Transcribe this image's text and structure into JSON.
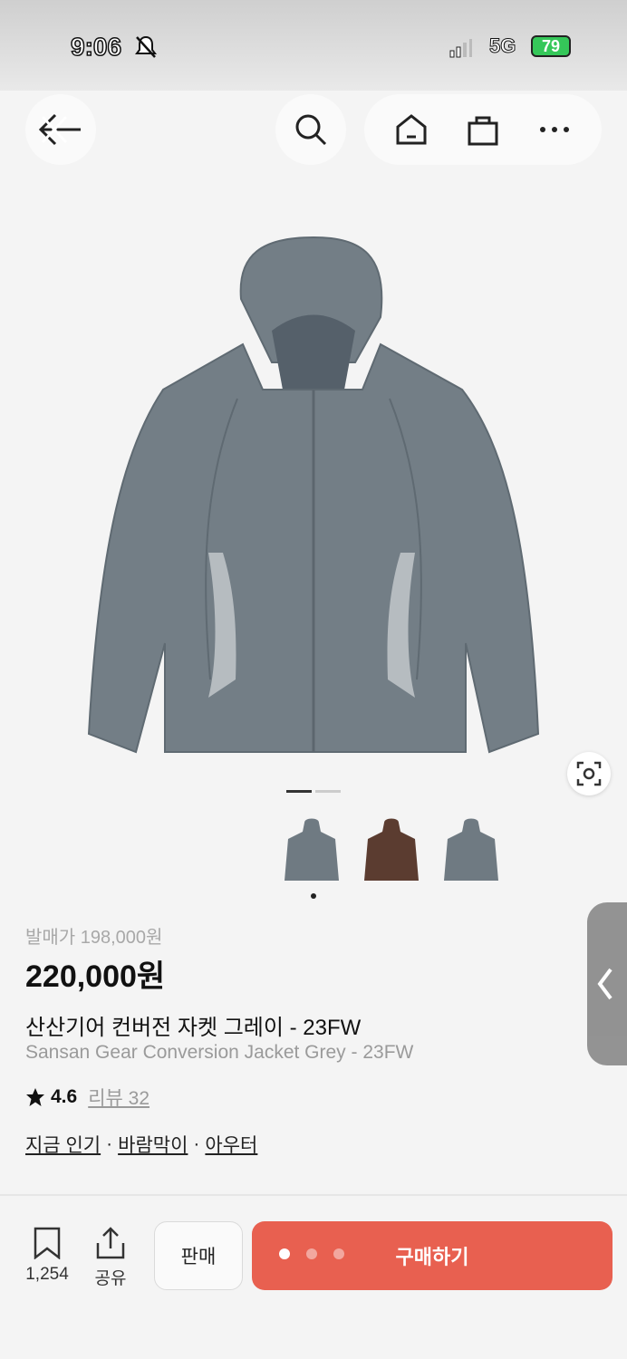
{
  "status_bar": {
    "time": "9:06",
    "network": "5G",
    "battery": "79"
  },
  "product": {
    "release_price": "발매가 198,000원",
    "price": "220,000원",
    "title_ko": "산산기어 컨버전 자켓 그레이 - 23FW",
    "title_en": "Sansan Gear Conversion Jacket Grey - 23FW",
    "rating": "4.6",
    "reviews": "리뷰 32",
    "tags": [
      "지금 인기",
      "바람막이",
      "아우터"
    ],
    "tag_separator": "·",
    "thumbnail_colors": [
      "#6f7a82",
      "#5b3c30",
      "#6f7a82"
    ],
    "jacket_color": "#737e86"
  },
  "bottom_bar": {
    "wishlist_count": "1,254",
    "share_label": "공유",
    "sell_label": "판매",
    "buy_label": "구매하기"
  },
  "colors": {
    "accent": "#e86050"
  }
}
